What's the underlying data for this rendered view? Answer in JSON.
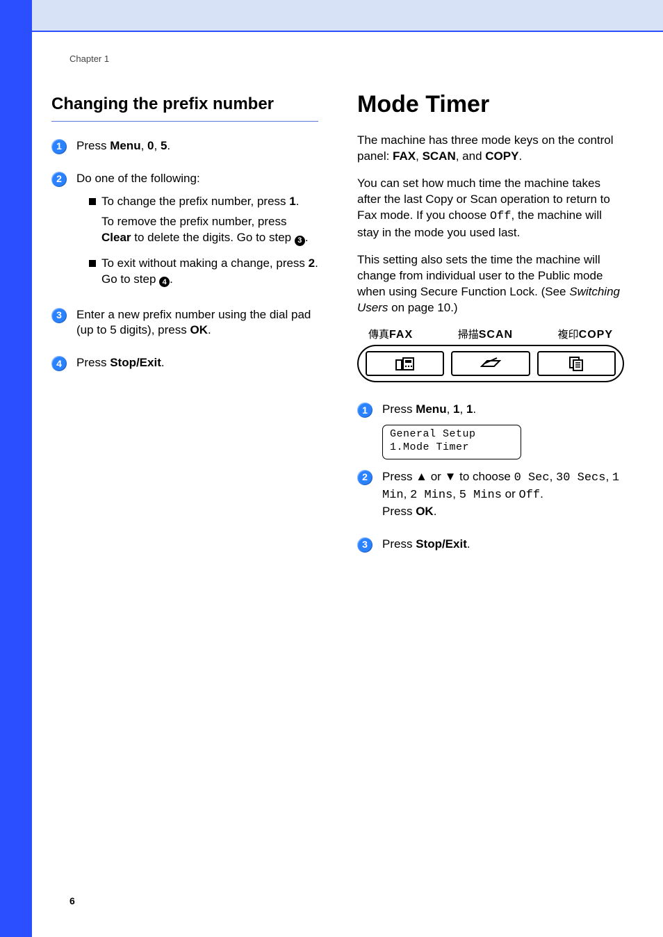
{
  "chapter": "Chapter 1",
  "page_number": "6",
  "left": {
    "heading": "Changing the prefix number",
    "steps": {
      "s1": {
        "prefix": "Press ",
        "k1": "Menu",
        "sep": ", ",
        "k2": "0",
        "k3": "5",
        "suffix": "."
      },
      "s2": {
        "intro": "Do one of the following:",
        "b1": {
          "line": "To change the prefix number, press ",
          "key": "1",
          "suffix": "."
        },
        "b1_sub_a": "To remove the prefix number, press ",
        "b1_sub_b": "Clear",
        "b1_sub_c": " to delete the digits. Go to step ",
        "b1_sub_ref": "3",
        "b1_sub_d": ".",
        "b2_a": "To exit without making a change, press ",
        "b2_key": "2",
        "b2_b": ". Go to step ",
        "b2_ref": "4",
        "b2_c": "."
      },
      "s3_a": "Enter a new prefix number using the dial pad (up to 5 digits), press ",
      "s3_key": "OK",
      "s3_b": ".",
      "s4_a": "Press ",
      "s4_key": "Stop/Exit",
      "s4_b": "."
    }
  },
  "right": {
    "heading": "Mode Timer",
    "p1_a": "The machine has three mode keys on the control panel: ",
    "p1_k1": "FAX",
    "p1_sep": ", ",
    "p1_k2": "SCAN",
    "p1_and": ", and ",
    "p1_k3": "COPY",
    "p1_b": ".",
    "p2_a": "You can set how much time the machine takes after the last Copy or Scan operation to return to Fax mode. If you choose ",
    "p2_off": "Off",
    "p2_b": ", the machine will stay in the mode you used last.",
    "p3_a": "This setting also sets the time the machine will change from individual user to the Public mode when using Secure Function Lock. (See ",
    "p3_link": "Switching Users",
    "p3_b": " on page 10.)",
    "panel": {
      "fax_cjk": "傳真",
      "fax_en": "FAX",
      "scan_cjk": "掃描",
      "scan_en": "SCAN",
      "copy_cjk": "複印",
      "copy_en": "COPY"
    },
    "steps": {
      "s1": {
        "prefix": "Press ",
        "k1": "Menu",
        "sep": ", ",
        "k2": "1",
        "k3": "1",
        "suffix": "."
      },
      "lcd_l1": "General Setup",
      "lcd_l2": "1.Mode Timer",
      "s2_a": "Press ▲ or ▼ to choose ",
      "s2_opt1": "0 Sec",
      "s2_c1": ", ",
      "s2_opt2": "30 Secs",
      "s2_c2": ", ",
      "s2_opt3": "1 Min",
      "s2_c3": ", ",
      "s2_opt4": "2 Mins",
      "s2_c4": ", ",
      "s2_opt5": "5 Mins",
      "s2_or": " or ",
      "s2_opt6": "Off",
      "s2_dot": ".",
      "s2_b": "Press ",
      "s2_ok": "OK",
      "s2_end": ".",
      "s3_a": "Press ",
      "s3_key": "Stop/Exit",
      "s3_b": "."
    }
  }
}
